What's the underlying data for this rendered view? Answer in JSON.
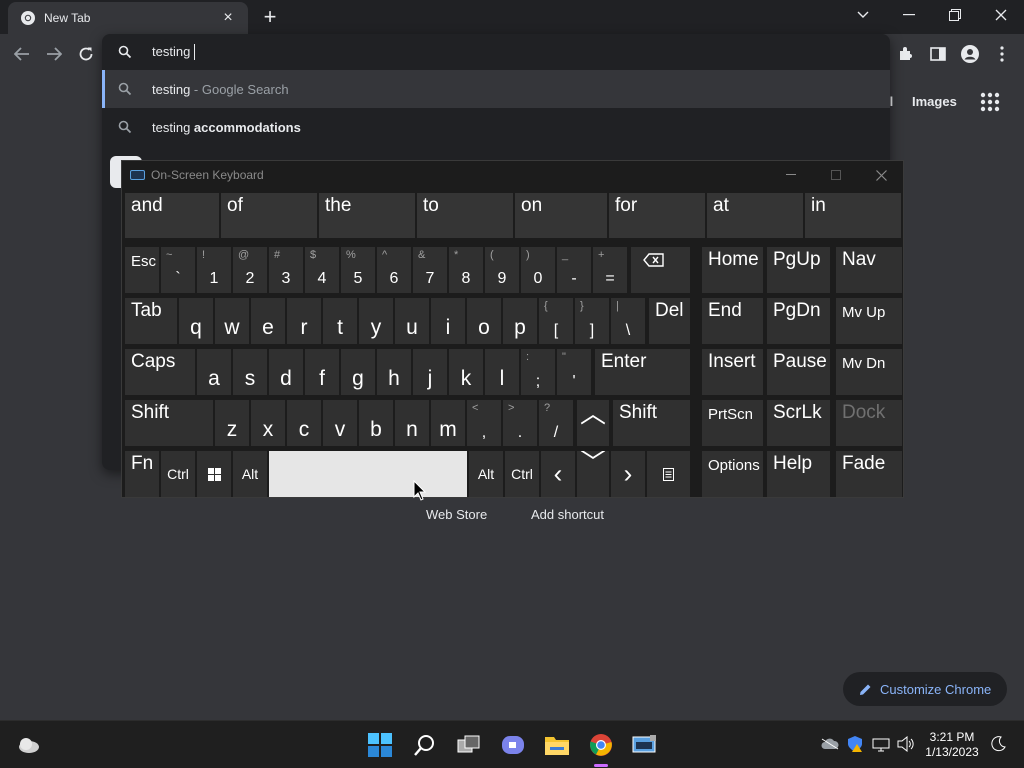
{
  "window": {
    "tab_title": "New Tab",
    "close_tab": "×",
    "new_tab": "+"
  },
  "omnibox": {
    "query": "testing",
    "suggestions": [
      {
        "prefix": "testing",
        "suffix": " - Google Search",
        "selected": true
      },
      {
        "prefix": "testing ",
        "suffix": "accommodations",
        "selected": false
      }
    ]
  },
  "page": {
    "gmail_partial": "il",
    "images_link": "Images",
    "web_store": "Web Store",
    "add_shortcut": "Add shortcut",
    "customize": "Customize Chrome"
  },
  "osk": {
    "title": "On-Screen Keyboard",
    "predictions": [
      "and",
      "of",
      "the",
      "to",
      "on",
      "for",
      "at",
      "in"
    ],
    "row1": {
      "esc": "Esc",
      "number_keys": [
        {
          "top": "~",
          "bottom": "`"
        },
        {
          "top": "!",
          "bottom": "1"
        },
        {
          "top": "@",
          "bottom": "2"
        },
        {
          "top": "#",
          "bottom": "3"
        },
        {
          "top": "$",
          "bottom": "4"
        },
        {
          "top": "%",
          "bottom": "5"
        },
        {
          "top": "^",
          "bottom": "6"
        },
        {
          "top": "&",
          "bottom": "7"
        },
        {
          "top": "*",
          "bottom": "8"
        },
        {
          "top": "(",
          "bottom": "9"
        },
        {
          "top": ")",
          "bottom": "0"
        },
        {
          "top": "_",
          "bottom": "-"
        },
        {
          "top": "+",
          "bottom": "="
        }
      ]
    },
    "row2": {
      "tab": "Tab",
      "letters": [
        "q",
        "w",
        "e",
        "r",
        "t",
        "y",
        "u",
        "i",
        "o",
        "p"
      ],
      "brackets": [
        {
          "top": "{",
          "bottom": "["
        },
        {
          "top": "}",
          "bottom": "]"
        },
        {
          "top": "|",
          "bottom": "\\"
        }
      ],
      "del": "Del"
    },
    "row3": {
      "caps": "Caps",
      "letters": [
        "a",
        "s",
        "d",
        "f",
        "g",
        "h",
        "j",
        "k",
        "l"
      ],
      "punct": [
        {
          "top": ":",
          "bottom": ";"
        },
        {
          "top": "\"",
          "bottom": "'"
        }
      ],
      "enter": "Enter"
    },
    "row4": {
      "shift": "Shift",
      "letters": [
        "z",
        "x",
        "c",
        "v",
        "b",
        "n",
        "m"
      ],
      "punct": [
        {
          "top": "<",
          "bottom": ","
        },
        {
          "top": ">",
          "bottom": "."
        },
        {
          "top": "?",
          "bottom": "/"
        }
      ],
      "shift_right": "Shift"
    },
    "row5": {
      "fn": "Fn",
      "ctrl": "Ctrl",
      "alt": "Alt",
      "alt_right": "Alt",
      "ctrl_right": "Ctrl"
    },
    "nav_block": {
      "home": "Home",
      "pgup": "PgUp",
      "nav": "Nav",
      "end": "End",
      "pgdn": "PgDn",
      "mvup": "Mv Up",
      "insert": "Insert",
      "pause": "Pause",
      "mvdn": "Mv Dn",
      "prtscn": "PrtScn",
      "scrlk": "ScrLk",
      "dock": "Dock",
      "options": "Options",
      "help": "Help",
      "fade": "Fade"
    }
  },
  "taskbar": {
    "time": "3:21 PM",
    "date": "1/13/2023"
  },
  "colors": {
    "accent": "#8ab4f8",
    "active_indicator": "#cc6bff"
  }
}
